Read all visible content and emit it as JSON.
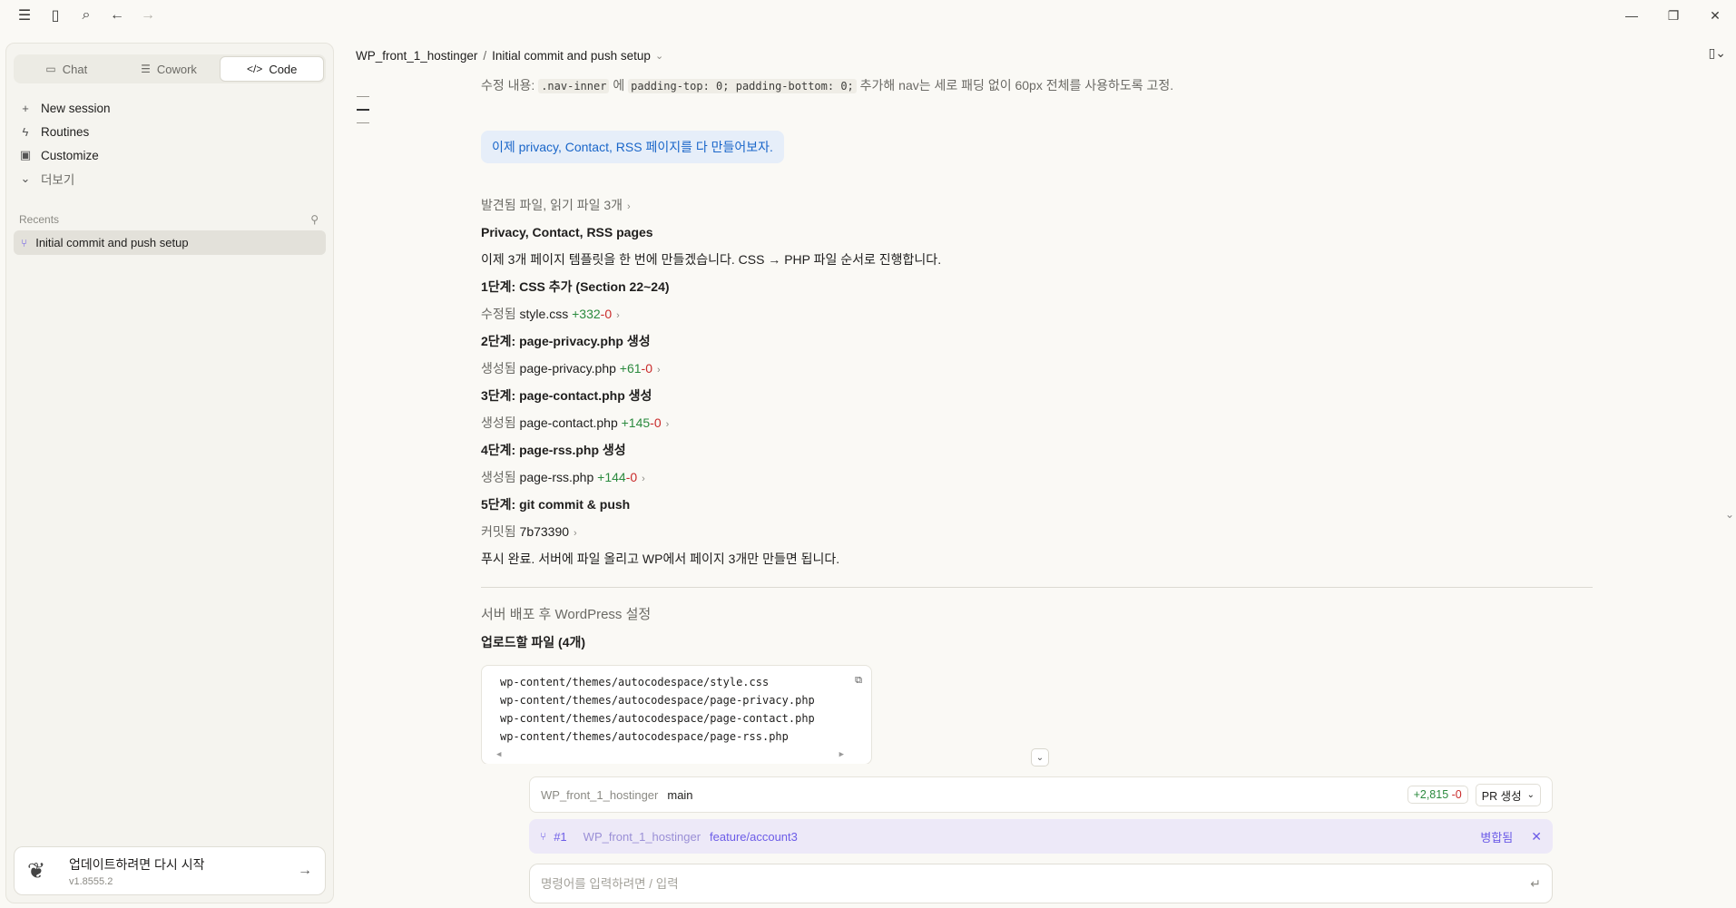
{
  "sidebar": {
    "tabs": [
      {
        "label": "Chat",
        "icon": "chat-bubble-icon"
      },
      {
        "label": "Cowork",
        "icon": "checklist-icon"
      },
      {
        "label": "Code",
        "icon": "code-brackets-icon"
      }
    ],
    "menu": [
      {
        "label": "New session",
        "icon": "plus-icon"
      },
      {
        "label": "Routines",
        "icon": "lightning-icon"
      },
      {
        "label": "Customize",
        "icon": "briefcase-icon"
      },
      {
        "label": "더보기",
        "icon": "chevron-down-icon"
      }
    ],
    "recents_label": "Recents",
    "recent_item": "Initial commit and push setup",
    "update": {
      "title": "업데이트하려면 다시 시작",
      "version": "v1.8555.2"
    }
  },
  "header": {
    "project": "WP_front_1_hostinger",
    "separator": "/",
    "session": "Initial commit and push setup"
  },
  "chat": {
    "top_note_prefix": "수정 내용: ",
    "top_note_code1": ".nav-inner",
    "top_note_mid1": " 에 ",
    "top_note_code2": "padding-top: 0; padding-bottom: 0;",
    "top_note_suffix": " 추가해 nav는 세로 패딩 없이 60px 전체를 사용하도록 고정.",
    "user_message": "이제 privacy, Contact, RSS 페이지를 다 만들어보자.",
    "found_files": "발견됨 파일, 읽기 파일 3개",
    "heading": "Privacy, Contact, RSS pages",
    "intro": "이제 3개 페이지 템플릿을 한 번에 만들겠습니다. CSS → PHP 파일 순서로 진행합니다.",
    "steps": [
      {
        "title": "1단계: CSS 추가 (Section 22~24)",
        "action": "수정됨",
        "file": "style.css",
        "plus": "+332",
        "minus": "-0"
      },
      {
        "title": "2단계: page-privacy.php 생성",
        "action": "생성됨",
        "file": "page-privacy.php",
        "plus": "+61",
        "minus": "-0"
      },
      {
        "title": "3단계: page-contact.php 생성",
        "action": "생성됨",
        "file": "page-contact.php",
        "plus": "+145",
        "minus": "-0"
      },
      {
        "title": "4단계: page-rss.php 생성",
        "action": "생성됨",
        "file": "page-rss.php",
        "plus": "+144",
        "minus": "-0"
      }
    ],
    "step5_title": "5단계: git commit & push",
    "commit_action": "커밋됨",
    "commit_hash": "7b73390",
    "push_done": "푸시 완료. 서버에 파일 올리고 WP에서 페이지 3개만 만들면 됩니다.",
    "deploy_heading": "서버 배포 후 WordPress 설정",
    "upload_heading": "업로드할 파일 (4개)",
    "code_lines": [
      "wp-content/themes/autocodespace/style.css",
      "wp-content/themes/autocodespace/page-privacy.php",
      "wp-content/themes/autocodespace/page-contact.php",
      "wp-content/themes/autocodespace/page-rss.php"
    ]
  },
  "repo_bar": {
    "repo": "WP_front_1_hostinger",
    "branch": "main",
    "diff_plus": "+2,815",
    "diff_minus": "-0",
    "pr_button": "PR 생성"
  },
  "pr_bar": {
    "number": "#1",
    "repo": "WP_front_1_hostinger",
    "branch": "feature/account3",
    "status": "병합됨"
  },
  "input": {
    "placeholder": "명령어를 입력하려면 / 입력"
  },
  "colors": {
    "accent_purple": "#6c5ce7",
    "diff_green": "#2b8a3e",
    "diff_red": "#c92a2a",
    "user_bubble_text": "#1a66c9"
  }
}
